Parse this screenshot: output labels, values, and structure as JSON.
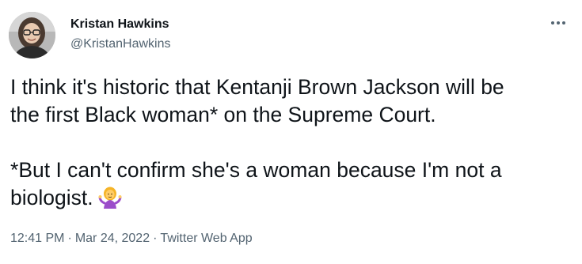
{
  "author": {
    "name": "Kristan Hawkins",
    "handle": "@KristanHawkins",
    "avatar_icon": "profile-photo"
  },
  "menu": {
    "icon": "more-horizontal-icon"
  },
  "tweet": {
    "lines": [
      "I think it's historic that Kentanji Brown Jackson will be",
      "the first Black woman* on the Supreme Court.",
      "*But I can't confirm she's a woman because I'm not a",
      "biologist."
    ],
    "emoji": "woman-shrugging-emoji"
  },
  "meta": {
    "time": "12:41 PM",
    "separator": "·",
    "date": "Mar 24, 2022",
    "source": "Twitter Web App"
  },
  "colors": {
    "text": "#0f1419",
    "secondary": "#536471"
  }
}
